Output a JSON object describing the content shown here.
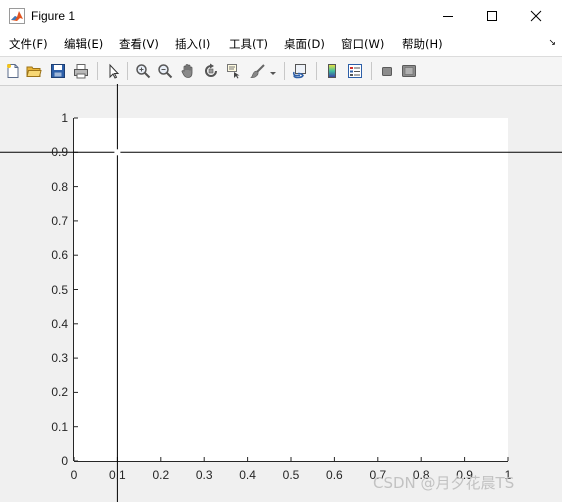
{
  "window": {
    "title": "Figure 1",
    "app_icon": "matlab-logo-icon",
    "controls": [
      "minimize-icon",
      "maximize-icon",
      "close-icon"
    ]
  },
  "menu": {
    "items": [
      "文件(F)",
      "编辑(E)",
      "查看(V)",
      "插入(I)",
      "工具(T)",
      "桌面(D)",
      "窗口(W)",
      "帮助(H)"
    ],
    "overflow_icon": "dock-arrow-icon",
    "overflow_glyph": "↘"
  },
  "toolbar": {
    "tools": [
      "new-figure-icon",
      "open-file-icon",
      "save-icon",
      "print-icon",
      "select-arrow-icon",
      "zoom-in-icon",
      "zoom-out-icon",
      "pan-hand-icon",
      "rotate-3d-icon",
      "data-cursor-icon",
      "brush-icon",
      "brush-dropdown-icon",
      "link-plot-icon",
      "colorbar-icon",
      "legend-icon",
      "hide-plot-tools-icon",
      "show-plot-tools-icon"
    ]
  },
  "colors": {
    "figure_background": "#f0f0f0",
    "axes_background": "#ffffff",
    "crosshair": "#000000",
    "tick_label": "#262626",
    "watermark": "#c2c2c2"
  },
  "chart_data": {
    "type": "line",
    "series": [],
    "xlim": [
      0,
      1
    ],
    "ylim": [
      0,
      1
    ],
    "x_ticks": [
      "0",
      "0.1",
      "0.2",
      "0.3",
      "0.4",
      "0.5",
      "0.6",
      "0.7",
      "0.8",
      "0.9",
      "1"
    ],
    "y_ticks": [
      "0",
      "0.1",
      "0.2",
      "0.3",
      "0.4",
      "0.5",
      "0.6",
      "0.7",
      "0.8",
      "0.9",
      "1"
    ],
    "grid": false,
    "crosshair": {
      "x": 0.1,
      "y": 0.9
    }
  },
  "watermark": "CSDN @月夕花晨TS"
}
